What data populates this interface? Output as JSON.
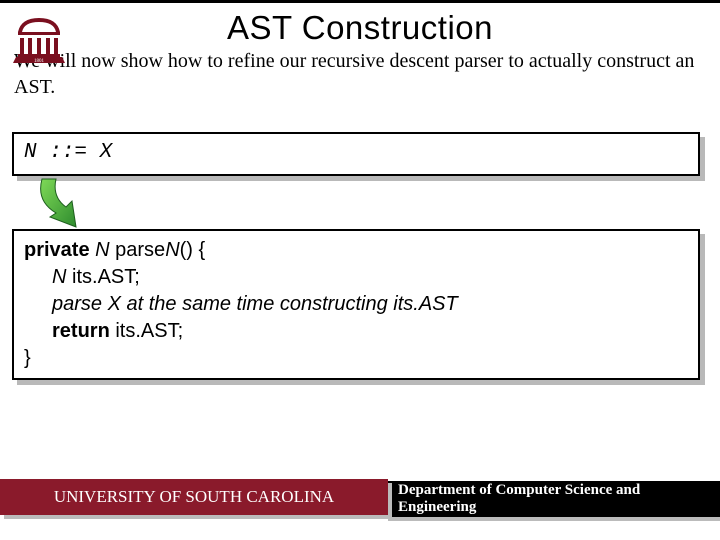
{
  "title": "AST Construction",
  "intro": "We will now show how to refine our recursive descent parser to actually construct an AST.",
  "grammar": "N  ::=  X",
  "code": {
    "l1a": "private",
    "l1b": " N",
    "l1c": " parse",
    "l1d": "N",
    "l1e": "() {",
    "l2a": "N",
    "l2b": " its.AST;",
    "l3": "parse X at the same time constructing its.AST",
    "l4a": "return",
    "l4b": " its.AST;",
    "l5": "}"
  },
  "footer": {
    "left": "UNIVERSITY OF SOUTH CAROLINA",
    "right": "Department of Computer Science and Engineering"
  }
}
